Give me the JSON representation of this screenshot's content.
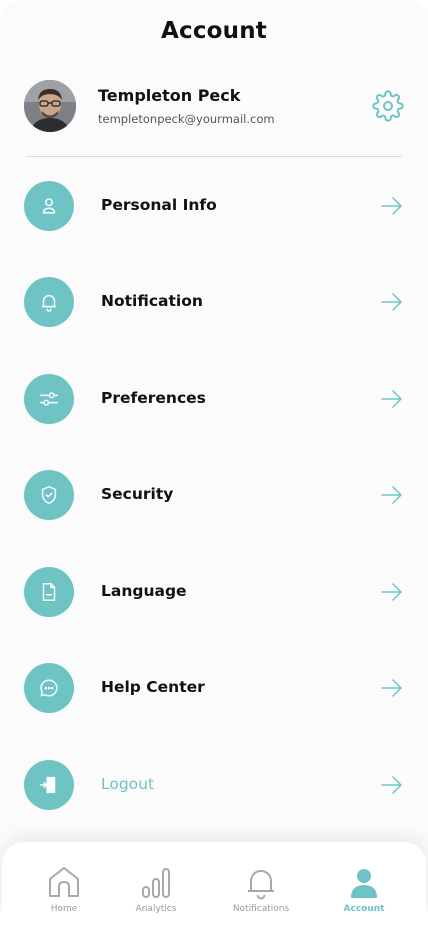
{
  "header": {
    "title": "Account"
  },
  "profile": {
    "name": "Templeton Peck",
    "email": "templetonpeck@yourmail.com",
    "settings_icon": "gear-icon"
  },
  "menu": {
    "items": [
      {
        "label": "Personal Info",
        "icon": "user-icon"
      },
      {
        "label": "Notification",
        "icon": "bell-icon"
      },
      {
        "label": "Preferences",
        "icon": "sliders-icon"
      },
      {
        "label": "Security",
        "icon": "shield-check-icon"
      },
      {
        "label": "Language",
        "icon": "document-icon"
      },
      {
        "label": "Help Center",
        "icon": "chat-bubble-icon"
      },
      {
        "label": "Logout",
        "icon": "logout-icon"
      }
    ]
  },
  "tabbar": {
    "tabs": [
      {
        "label": "Home",
        "icon": "home-icon",
        "active": false
      },
      {
        "label": "Analytics",
        "icon": "bar-chart-icon",
        "active": false
      },
      {
        "label": "Notifications",
        "icon": "bell-icon",
        "active": false
      },
      {
        "label": "Account",
        "icon": "user-icon",
        "active": true
      }
    ]
  },
  "colors": {
    "accent": "#6ec4c4",
    "text": "#111111",
    "muted": "#9a9a9a",
    "background": "#fbfbfb"
  }
}
